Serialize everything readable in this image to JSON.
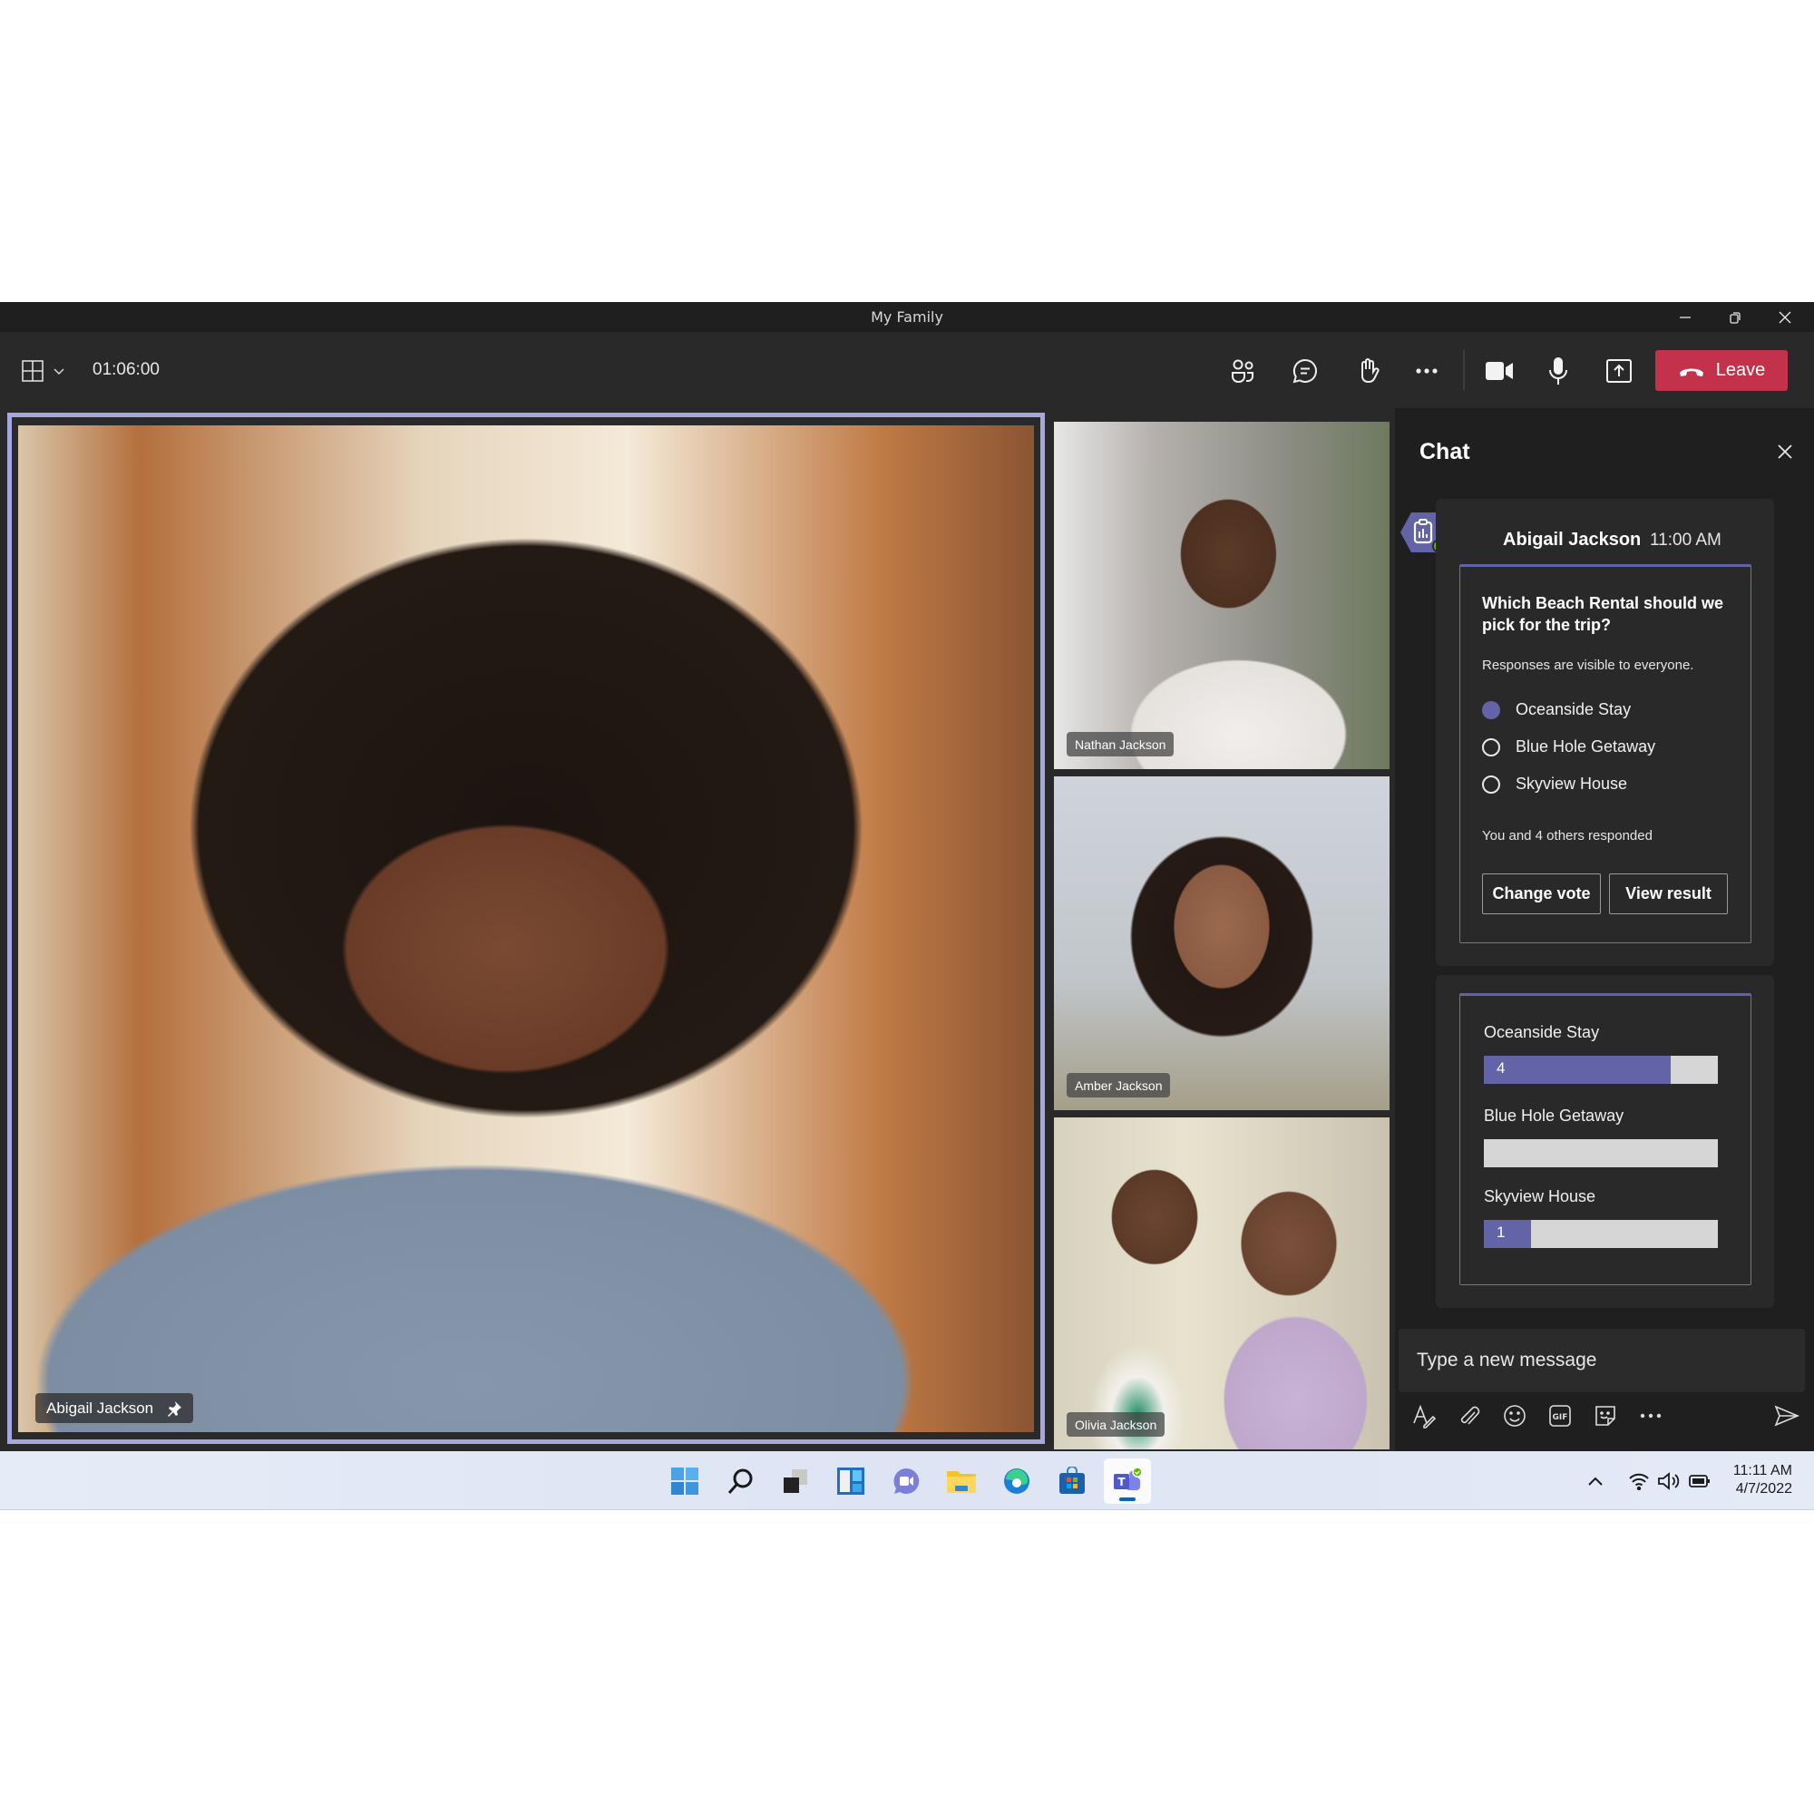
{
  "window": {
    "title": "My Family",
    "controls": [
      "minimize",
      "restore",
      "close"
    ]
  },
  "toolbar": {
    "layout_icon": "grid-layout-icon",
    "call_duration": "01:06:00",
    "buttons": [
      {
        "name": "people",
        "icon": "people-icon"
      },
      {
        "name": "chat",
        "icon": "chat-icon"
      },
      {
        "name": "raise-hand",
        "icon": "hand-icon"
      },
      {
        "name": "more",
        "icon": "more-icon"
      },
      {
        "name": "camera",
        "icon": "camera-icon"
      },
      {
        "name": "mic",
        "icon": "mic-icon"
      },
      {
        "name": "share",
        "icon": "share-icon"
      }
    ],
    "leave_label": "Leave",
    "leave_color": "#c4314b"
  },
  "participants": {
    "main": {
      "name": "Abigail Jackson",
      "pinned": true
    },
    "side": [
      {
        "name": "Nathan Jackson"
      },
      {
        "name": "Amber Jackson"
      },
      {
        "name": "Olivia Jackson"
      }
    ],
    "active_border_color": "#a6a7dc"
  },
  "chat": {
    "title": "Chat",
    "message": {
      "author": "Abigail Jackson",
      "time": "11:00 AM",
      "poll": {
        "question": "Which Beach Rental should we pick for the trip?",
        "note": "Responses are visible to everyone.",
        "options": [
          {
            "label": "Oceanside Stay",
            "selected": true
          },
          {
            "label": "Blue Hole Getaway",
            "selected": false
          },
          {
            "label": "Skyview House",
            "selected": false
          }
        ],
        "responded": "You and 4 others responded",
        "change_vote_label": "Change vote",
        "view_result_label": "View result"
      }
    },
    "results": {
      "total": 5,
      "items": [
        {
          "label": "Oceanside Stay",
          "count": "4",
          "fraction": 0.8
        },
        {
          "label": "Blue Hole Getaway",
          "count": "",
          "fraction": 0
        },
        {
          "label": "Skyview House",
          "count": "1",
          "fraction": 0.2
        }
      ]
    },
    "compose": {
      "placeholder": "Type a new message",
      "tools": [
        "format-icon",
        "attach-icon",
        "emoji-icon",
        "gif-icon",
        "sticker-icon",
        "more-icon"
      ],
      "send_icon": "send-icon"
    },
    "accent_color": "#6264a7"
  },
  "taskbar": {
    "apps": [
      "start",
      "search",
      "task-view",
      "widgets",
      "chat",
      "file-explorer",
      "edge",
      "store",
      "teams"
    ],
    "active_app": "teams",
    "clock_time": "11:11 AM",
    "clock_date": "4/7/2022"
  }
}
